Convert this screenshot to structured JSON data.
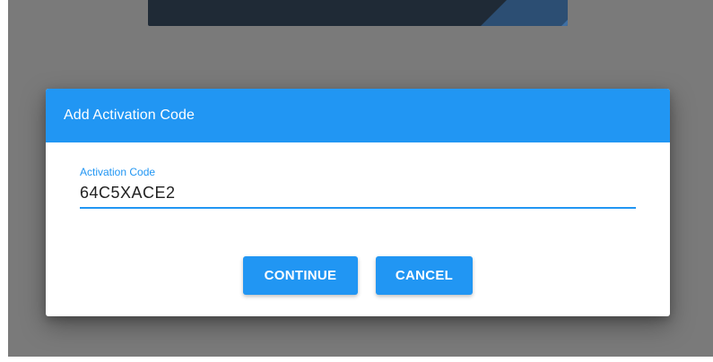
{
  "dialog": {
    "title": "Add Activation Code",
    "field": {
      "label": "Activation Code",
      "value": "64C5XACE2"
    },
    "buttons": {
      "continue_label": "CONTINUE",
      "cancel_label": "CANCEL"
    }
  },
  "colors": {
    "accent": "#2196f3",
    "backdrop": "#7a7a7a",
    "background_card": "#1f2a36"
  }
}
